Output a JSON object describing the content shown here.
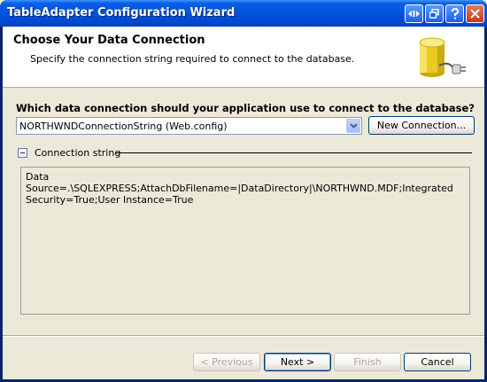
{
  "window": {
    "title": "TableAdapter Configuration Wizard"
  },
  "header": {
    "title": "Choose Your Data Connection",
    "subtitle": "Specify the connection string required to connect to the database."
  },
  "question": {
    "label": "Which data connection should your application use to connect to the database?"
  },
  "connection_select": {
    "value": "NORTHWNDConnectionString (Web.config)"
  },
  "new_connection_button": {
    "label": "New Connection..."
  },
  "connection_string_section": {
    "label": "Connection string",
    "value": "Data Source=.\\SQLEXPRESS;AttachDbFilename=|DataDirectory|\\NORTHWND.MDF;Integrated Security=True;User Instance=True"
  },
  "footer": {
    "previous_label": "< Previous",
    "next_label": "Next >",
    "finish_label": "Finish",
    "cancel_label": "Cancel"
  },
  "colors": {
    "titlebar": "#0052e0",
    "dialog_bg": "#ece9d8",
    "header_bg": "#ffffff",
    "disabled_text": "#aca899"
  }
}
